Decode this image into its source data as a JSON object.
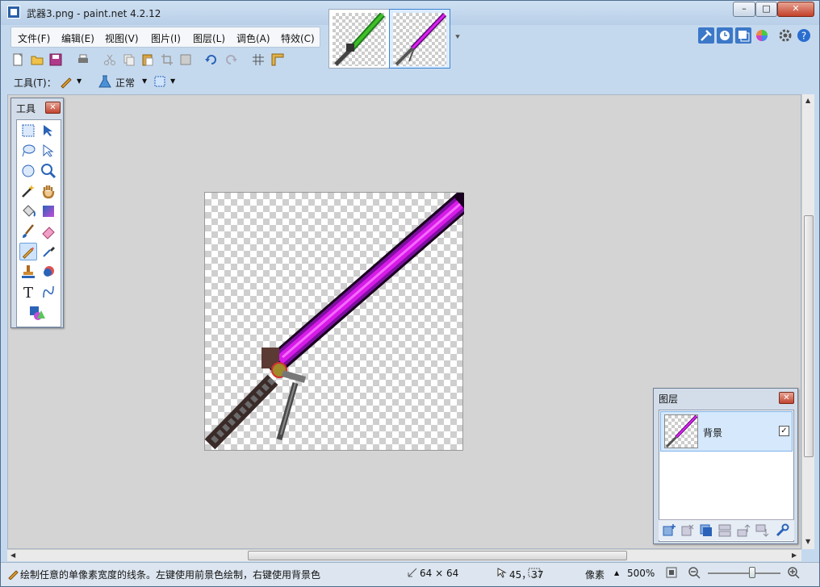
{
  "window": {
    "title": "武器3.png - paint.net 4.2.12",
    "min_label": "–",
    "max_label": "□",
    "close_label": "✕"
  },
  "menu": {
    "items": [
      {
        "label": "文件(F)"
      },
      {
        "label": "编辑(E)"
      },
      {
        "label": "视图(V)"
      },
      {
        "label": "图片(I)"
      },
      {
        "label": "图层(L)"
      },
      {
        "label": "调色(A)"
      },
      {
        "label": "特效(C)"
      }
    ]
  },
  "toolbar": {
    "tool_label": "工具(T)：",
    "blend_mode": "正常"
  },
  "tools_panel": {
    "title": "工具"
  },
  "layers_panel": {
    "title": "图层",
    "layer_name": "背景",
    "layer_visible": "✓"
  },
  "status": {
    "hint": "绘制任意的单像素宽度的线条。左键使用前景色绘制，右键使用背景色",
    "image_size": "64 × 64",
    "cursor_pos": "45，37",
    "unit": "像素",
    "zoom": "500%"
  },
  "colors": {
    "blade_magenta": "#e020f0",
    "blade_dark": "#5a0a7a",
    "green_blade": "#3fbf2a",
    "hilt_gray": "#555555"
  }
}
